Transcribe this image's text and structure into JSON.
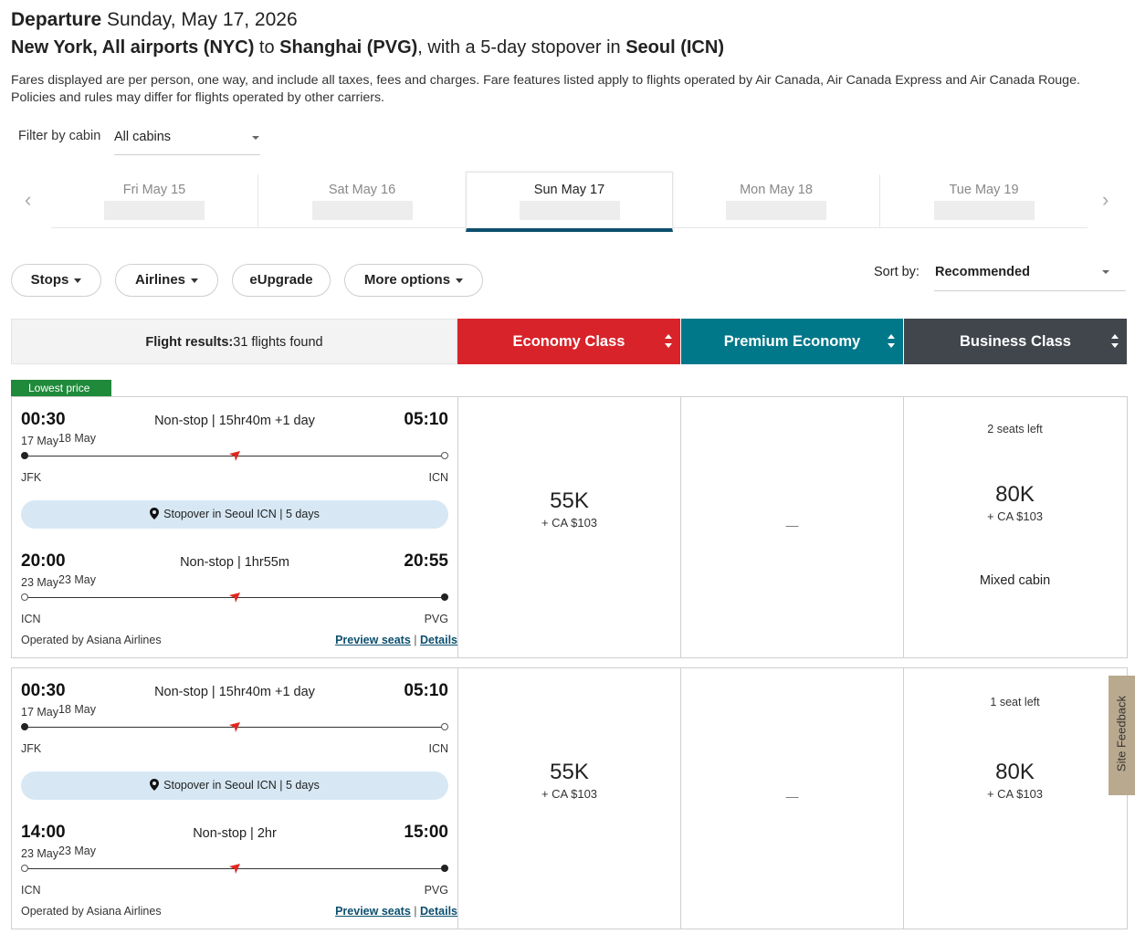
{
  "header": {
    "departure_label": "Departure",
    "departure_date": "Sunday, May 17, 2026",
    "origin": "New York, All airports (NYC)",
    "to_word": "to",
    "destination": "Shanghai (PVG)",
    "stopover_prefix": ", with a 5-day stopover in",
    "stopover_city": "Seoul (ICN)",
    "disclaimer": "Fares displayed are per person, one way, and include all taxes, fees and charges. Fare features listed apply to flights operated by Air Canada, Air Canada Express and Air Canada Rouge. Policies and rules may differ for flights operated by other carriers."
  },
  "filter": {
    "label": "Filter by cabin",
    "value": "All cabins"
  },
  "dates": [
    {
      "label": "Fri May 15",
      "active": false
    },
    {
      "label": "Sat May 16",
      "active": false
    },
    {
      "label": "Sun May 17",
      "active": true
    },
    {
      "label": "Mon May 18",
      "active": false
    },
    {
      "label": "Tue May 19",
      "active": false
    }
  ],
  "filters": {
    "stops": "Stops",
    "airlines": "Airlines",
    "eupgrade": "eUpgrade",
    "more": "More options"
  },
  "sort": {
    "label": "Sort by:",
    "value": "Recommended"
  },
  "results": {
    "label": "Flight results:",
    "count": "31 flights found"
  },
  "cabins": {
    "economy": {
      "label": "Economy Class",
      "color": "#d8232a"
    },
    "premium": {
      "label": "Premium Economy",
      "color": "#00788a"
    },
    "business": {
      "label": "Business Class",
      "color": "#41464d"
    }
  },
  "badge": "Lowest price",
  "flights": [
    {
      "seg1": {
        "dep": "00:30",
        "arr": "05:10",
        "info": "Non-stop | 15hr40m +1 day",
        "dep_date": "17 May",
        "arr_date": "18 May",
        "from": "JFK",
        "to": "ICN"
      },
      "stopover": "Stopover in Seoul ICN | 5 days",
      "seg2": {
        "dep": "20:00",
        "arr": "20:55",
        "info": "Non-stop | 1hr55m",
        "dep_date": "23 May",
        "arr_date": "23 May",
        "from": "ICN",
        "to": "PVG"
      },
      "operated": "Operated by Asiana Airlines",
      "preview": "Preview seats",
      "details": "Details",
      "economy": {
        "points": "55K",
        "cash": "+ CA $103"
      },
      "premium": "—",
      "business": {
        "seats": "2 seats left",
        "points": "80K",
        "cash": "+ CA $103",
        "note": "Mixed cabin"
      }
    },
    {
      "seg1": {
        "dep": "00:30",
        "arr": "05:10",
        "info": "Non-stop | 15hr40m +1 day",
        "dep_date": "17 May",
        "arr_date": "18 May",
        "from": "JFK",
        "to": "ICN"
      },
      "stopover": "Stopover in Seoul ICN | 5 days",
      "seg2": {
        "dep": "14:00",
        "arr": "15:00",
        "info": "Non-stop | 2hr",
        "dep_date": "23 May",
        "arr_date": "23 May",
        "from": "ICN",
        "to": "PVG"
      },
      "operated": "Operated by Asiana Airlines",
      "preview": "Preview seats",
      "details": "Details",
      "economy": {
        "points": "55K",
        "cash": "+ CA $103"
      },
      "premium": "—",
      "business": {
        "seats": "1 seat left",
        "points": "80K",
        "cash": "+ CA $103"
      }
    }
  ],
  "feedback": "Site Feedback",
  "icons": {
    "nav_prev": "chevron-left-icon",
    "nav_next": "chevron-right-icon",
    "plane": "airline-logo-icon",
    "pin": "location-pin-icon"
  }
}
